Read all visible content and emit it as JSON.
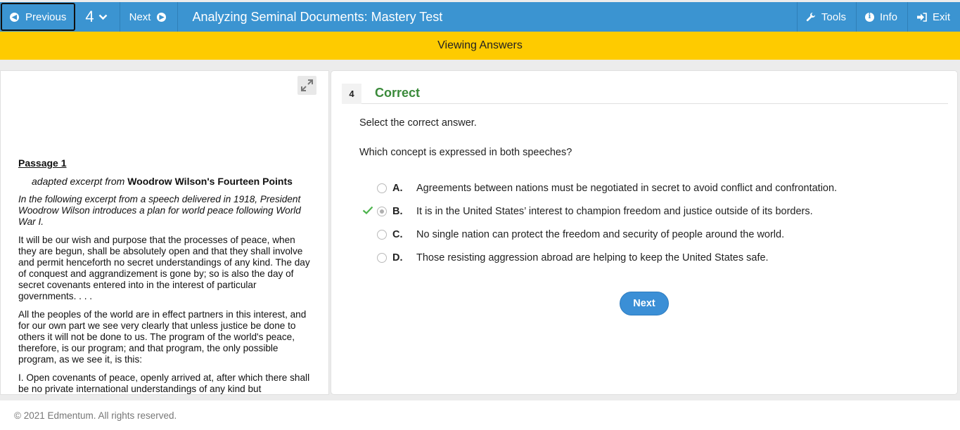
{
  "topbar": {
    "previous_label": "Previous",
    "question_number": "4",
    "next_label": "Next",
    "title": "Analyzing Seminal Documents: Mastery Test",
    "tools_label": "Tools",
    "info_label": "Info",
    "exit_label": "Exit"
  },
  "banner": {
    "text": "Viewing Answers"
  },
  "passage": {
    "title": "Passage 1",
    "source_prefix": "adapted excerpt from",
    "source_name": "Woodrow Wilson's Fourteen Points",
    "intro": "In the following excerpt from a speech delivered in 1918, President Woodrow Wilson introduces a plan for world peace following World War I.",
    "paragraphs": [
      "It will be our wish and purpose that the processes of peace, when they are begun, shall be absolutely open and that they shall involve and permit henceforth no secret understandings of any kind. The day of conquest and aggrandizement is gone by; so is also the day of secret covenants entered into in the interest of particular governments. . . .",
      "All the peoples of the world are in effect partners in this interest, and for our own part we see very clearly that unless justice be done to others it will not be done to us. The program of the world's peace, therefore, is our program; and that program, the only possible program, as we see it, is this:",
      "I. Open covenants of peace, openly arrived at, after which there shall be no private international understandings of any kind but"
    ]
  },
  "question": {
    "number": "4",
    "status": "Correct",
    "instruction": "Select the correct answer.",
    "text": "Which concept is expressed in both speeches?",
    "choices": [
      {
        "letter": "A.",
        "text": "Agreements between nations must be negotiated in secret to avoid conflict and confrontation."
      },
      {
        "letter": "B.",
        "text": "It is in the United States’ interest to champion freedom and justice outside of its borders."
      },
      {
        "letter": "C.",
        "text": "No single nation can protect the freedom and security of people around the world."
      },
      {
        "letter": "D.",
        "text": "Those resisting aggression abroad are helping to keep the United States safe."
      }
    ],
    "next_label": "Next"
  },
  "footer": {
    "copyright": "© 2021 Edmentum. All rights reserved."
  },
  "colors": {
    "topbar": "#3b94d1",
    "banner": "#fecb00",
    "correct": "#3a8a3a",
    "next_button": "#3b8fd6"
  },
  "icons": {
    "previous": "arrow-left-circle-icon",
    "question_dropdown": "chevron-down-icon",
    "next": "arrow-right-circle-icon",
    "tools": "wrench-icon",
    "info": "info-circle-icon",
    "exit": "sign-out-icon",
    "expand": "expand-arrows-icon",
    "correct_mark": "checkmark-icon"
  }
}
